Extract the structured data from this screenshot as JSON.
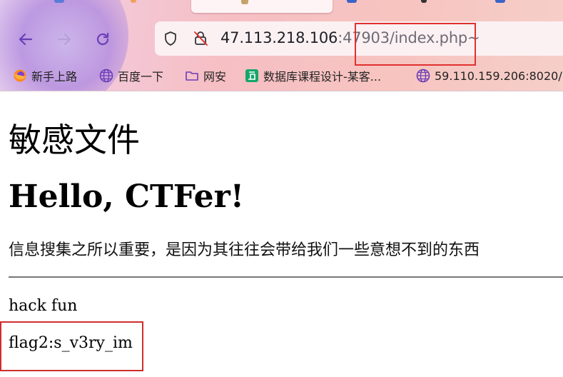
{
  "browser": {
    "url_host": "47.113.218.106",
    "url_rest": ":47903/index.php~",
    "icons": {
      "back": "back-arrow-icon",
      "forward": "forward-arrow-icon",
      "reload": "reload-icon",
      "shield": "shield-icon",
      "lock": "insecure-lock-icon"
    },
    "bookmarks": [
      {
        "label": "新手上路",
        "icon": "firefox-icon"
      },
      {
        "label": "百度一下",
        "icon": "globe-icon"
      },
      {
        "label": "网安",
        "icon": "folder-icon"
      },
      {
        "label": "数据库课程设计-某客...",
        "icon": "site-icon"
      },
      {
        "label": "59.110.159.206:8020/",
        "icon": "globe-icon"
      }
    ]
  },
  "page": {
    "title": "敏感文件",
    "heading": "Hello, CTFer!",
    "paragraph": "信息搜集之所以重要，是因为其往往会带给我们一些意想不到的东西",
    "hack_text": "hack fun",
    "flag_text": "flag2:s_v3ry_im"
  },
  "colors": {
    "highlight_box": "#e0312f",
    "accent_icon": "#6b3fb7"
  }
}
